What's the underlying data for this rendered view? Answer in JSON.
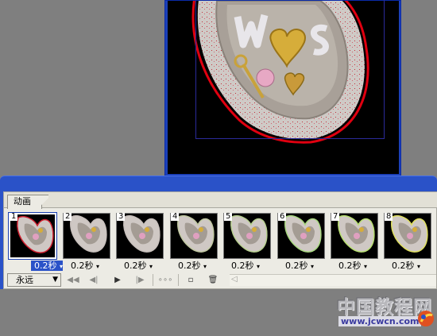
{
  "animation_panel": {
    "tab_label": "动画",
    "frames": [
      {
        "number": "1",
        "delay": "0.2秒",
        "selected": true
      },
      {
        "number": "2",
        "delay": "0.2秒",
        "selected": false
      },
      {
        "number": "3",
        "delay": "0.2秒",
        "selected": false
      },
      {
        "number": "4",
        "delay": "0.2秒",
        "selected": false
      },
      {
        "number": "5",
        "delay": "0.2秒",
        "selected": false
      },
      {
        "number": "6",
        "delay": "0.2秒",
        "selected": false
      },
      {
        "number": "7",
        "delay": "0.2秒",
        "selected": false
      },
      {
        "number": "8",
        "delay": "0.2秒",
        "selected": false
      }
    ],
    "loop_option": "永远",
    "controls": {
      "first_frame": "◀◀",
      "previous_frame": "◀|",
      "play": "▶",
      "next_frame": "|▶",
      "tween": "∘∘∘",
      "new_frame": "▫",
      "delete_frame": "🗑"
    }
  },
  "watermark": {
    "title": "中国教程网",
    "url": "www.jcwcn.com"
  },
  "colors": {
    "panel_blue": "#2a52c8",
    "panel_face": "#ecebe4",
    "workspace_gray": "#7f7f7f",
    "canvas_black": "#000000"
  }
}
